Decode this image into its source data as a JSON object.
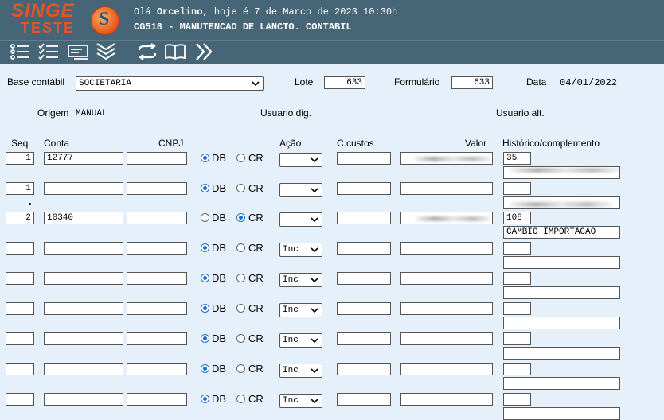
{
  "header": {
    "logo_main": "SINGE",
    "logo_sub": "TESTE",
    "greeting_prefix": "Olá",
    "user": "Orcelino",
    "greeting_suffix": ", hoje é 7 de Marco de 2023 10:30h",
    "screen_title": "CG518 - MANUTENCAO DE LANCTO. CONTABIL"
  },
  "toolbar": {
    "icons": [
      "list-icon",
      "checklist-icon",
      "card-icon",
      "chevrons-down-icon",
      "sync-icon",
      "book-icon",
      "chevrons-right-icon"
    ]
  },
  "form": {
    "base_label": "Base contábil",
    "base_value": "SOCIETARIA",
    "lote_label": "Lote",
    "lote_value": "633",
    "formulario_label": "Formulário",
    "formulario_value": "633",
    "data_label": "Data",
    "data_value": "04/01/2022",
    "origem_label": "Origem",
    "origem_value": "MANUAL",
    "usuario_dig_label": "Usuario dig.",
    "usuario_alt_label": "Usuario alt."
  },
  "columns": {
    "seq": "Seq",
    "conta": "Conta",
    "cnpj": "CNPJ",
    "acao": "Ação",
    "ccustos": "C.custos",
    "valor": "Valor",
    "historico": "Histórico/complemento",
    "db": "DB",
    "cr": "CR"
  },
  "rows": [
    {
      "seq": "1",
      "conta": "12777",
      "cnpj": "",
      "dc": "DB",
      "acao": "",
      "ccustos": "",
      "hist": "35",
      "comp": ""
    },
    {
      "seq": "1",
      "conta": "",
      "cnpj": "",
      "dc": "DB",
      "acao": "",
      "ccustos": "",
      "hist": "",
      "comp": ""
    },
    {
      "seq": "2",
      "conta": "10340",
      "cnpj": "",
      "dc": "CR",
      "acao": "",
      "ccustos": "",
      "hist": "108",
      "comp": "CAMBIO IMPORTACAO"
    },
    {
      "seq": "",
      "conta": "",
      "cnpj": "",
      "dc": "DB",
      "acao": "Inc",
      "ccustos": "",
      "hist": "",
      "comp": ""
    },
    {
      "seq": "",
      "conta": "",
      "cnpj": "",
      "dc": "DB",
      "acao": "Inc",
      "ccustos": "",
      "hist": "",
      "comp": ""
    },
    {
      "seq": "",
      "conta": "",
      "cnpj": "",
      "dc": "DB",
      "acao": "Inc",
      "ccustos": "",
      "hist": "",
      "comp": ""
    },
    {
      "seq": "",
      "conta": "",
      "cnpj": "",
      "dc": "DB",
      "acao": "Inc",
      "ccustos": "",
      "hist": "",
      "comp": ""
    },
    {
      "seq": "",
      "conta": "",
      "cnpj": "",
      "dc": "DB",
      "acao": "Inc",
      "ccustos": "",
      "hist": "",
      "comp": ""
    },
    {
      "seq": "",
      "conta": "",
      "cnpj": "",
      "dc": "DB",
      "acao": "Inc",
      "ccustos": "",
      "hist": "",
      "comp": ""
    }
  ]
}
